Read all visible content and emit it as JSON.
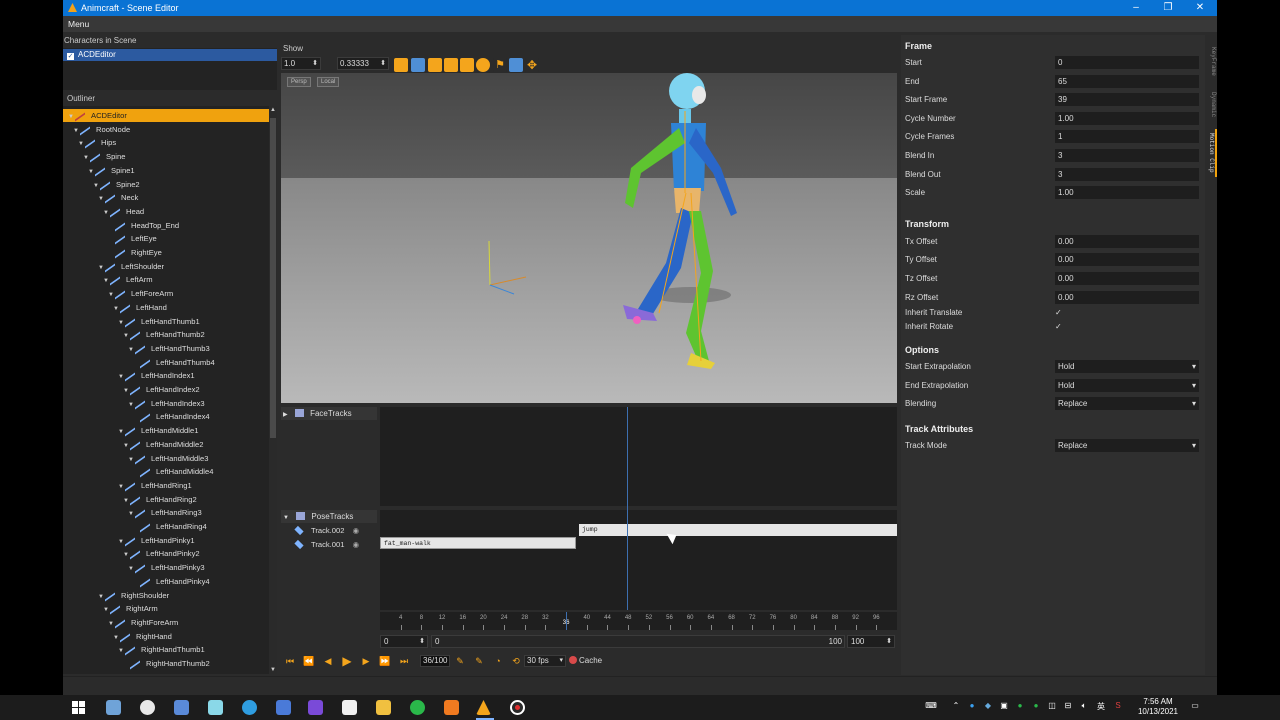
{
  "window": {
    "title": "Animcraft - Scene Editor",
    "menu": "Menu"
  },
  "characters": {
    "label": "Characters in Scene",
    "selected": "ACDEditor"
  },
  "outliner": {
    "label": "Outliner",
    "nodes": [
      {
        "name": "ACDEditor",
        "depth": 1
      },
      {
        "name": "RootNode",
        "depth": 2
      },
      {
        "name": "Hips",
        "depth": 3
      },
      {
        "name": "Spine",
        "depth": 4
      },
      {
        "name": "Spine1",
        "depth": 5
      },
      {
        "name": "Spine2",
        "depth": 6
      },
      {
        "name": "Neck",
        "depth": 7
      },
      {
        "name": "Head",
        "depth": 8
      },
      {
        "name": "HeadTop_End",
        "depth": 9
      },
      {
        "name": "LeftEye",
        "depth": 9
      },
      {
        "name": "RightEye",
        "depth": 9
      },
      {
        "name": "LeftShoulder",
        "depth": 7
      },
      {
        "name": "LeftArm",
        "depth": 8
      },
      {
        "name": "LeftForeArm",
        "depth": 9
      },
      {
        "name": "LeftHand",
        "depth": 10
      },
      {
        "name": "LeftHandThumb1",
        "depth": 11
      },
      {
        "name": "LeftHandThumb2",
        "depth": 12
      },
      {
        "name": "LeftHandThumb3",
        "depth": 13
      },
      {
        "name": "LeftHandThumb4",
        "depth": 14
      },
      {
        "name": "LeftHandIndex1",
        "depth": 11
      },
      {
        "name": "LeftHandIndex2",
        "depth": 12
      },
      {
        "name": "LeftHandIndex3",
        "depth": 13
      },
      {
        "name": "LeftHandIndex4",
        "depth": 14
      },
      {
        "name": "LeftHandMiddle1",
        "depth": 11
      },
      {
        "name": "LeftHandMiddle2",
        "depth": 12
      },
      {
        "name": "LeftHandMiddle3",
        "depth": 13
      },
      {
        "name": "LeftHandMiddle4",
        "depth": 14
      },
      {
        "name": "LeftHandRing1",
        "depth": 11
      },
      {
        "name": "LeftHandRing2",
        "depth": 12
      },
      {
        "name": "LeftHandRing3",
        "depth": 13
      },
      {
        "name": "LeftHandRing4",
        "depth": 14
      },
      {
        "name": "LeftHandPinky1",
        "depth": 11
      },
      {
        "name": "LeftHandPinky2",
        "depth": 12
      },
      {
        "name": "LeftHandPinky3",
        "depth": 13
      },
      {
        "name": "LeftHandPinky4",
        "depth": 14
      },
      {
        "name": "RightShoulder",
        "depth": 7
      },
      {
        "name": "RightArm",
        "depth": 8
      },
      {
        "name": "RightForeArm",
        "depth": 9
      },
      {
        "name": "RightHand",
        "depth": 10
      },
      {
        "name": "RightHandThumb1",
        "depth": 11
      },
      {
        "name": "RightHandThumb2",
        "depth": 12
      }
    ]
  },
  "toolbar": {
    "show_label": "Show",
    "scale_value": "1.0",
    "speed_value": "0.33333",
    "icons": [
      "cube-icon",
      "frame-icon",
      "grid-icon",
      "grid2-icon",
      "wire-icon",
      "light-icon",
      "flag-icon",
      "joint-icon",
      "move-icon"
    ]
  },
  "viewport": {
    "btn_persp": "Persp",
    "btn_local": "Local"
  },
  "tracks": {
    "face_tracks": "FaceTracks",
    "pose_tracks": "PoseTracks",
    "rows": [
      {
        "name": "Track.002"
      },
      {
        "name": "Track.001"
      }
    ],
    "clip_jump": "jump",
    "clip_walk": "fat_man-walk"
  },
  "timeline": {
    "ticks": [
      "4",
      "8",
      "12",
      "16",
      "20",
      "24",
      "28",
      "32",
      "36",
      "40",
      "44",
      "48",
      "52",
      "56",
      "60",
      "64",
      "68",
      "72",
      "76",
      "80",
      "84",
      "88",
      "92",
      "96"
    ],
    "current_marker": "36",
    "range_start": "0",
    "range_bar_start": "0",
    "range_bar_end": "100",
    "range_end": "100"
  },
  "playback": {
    "frame_display": "36/100",
    "fps": "30 fps",
    "cache_label": "Cache"
  },
  "properties": {
    "frame_section": "Frame",
    "frame_fields": [
      {
        "label": "Start",
        "value": "0"
      },
      {
        "label": "End",
        "value": "65"
      },
      {
        "label": "Start Frame",
        "value": "39"
      },
      {
        "label": "Cycle Number",
        "value": "1.00"
      },
      {
        "label": "Cycle Frames",
        "value": "1"
      },
      {
        "label": "Blend In",
        "value": "3"
      },
      {
        "label": "Blend Out",
        "value": "3"
      },
      {
        "label": "Scale",
        "value": "1.00"
      }
    ],
    "transform_section": "Transform",
    "transform_fields": [
      {
        "label": "Tx Offset",
        "value": "0.00"
      },
      {
        "label": "Ty Offset",
        "value": "0.00"
      },
      {
        "label": "Tz Offset",
        "value": "0.00"
      },
      {
        "label": "Rz Offset",
        "value": "0.00"
      }
    ],
    "inherit_translate": "Inherit Translate",
    "inherit_rotate": "Inherit Rotate",
    "options_section": "Options",
    "option_fields": [
      {
        "label": "Start Extrapolation",
        "value": "Hold"
      },
      {
        "label": "End Extrapolation",
        "value": "Hold"
      },
      {
        "label": "Blending",
        "value": "Replace"
      }
    ],
    "track_attr_section": "Track Attributes",
    "track_mode_label": "Track Mode",
    "track_mode_value": "Replace"
  },
  "side_tabs": [
    "KeyFrame",
    "Dynamic",
    "Motion Clip"
  ],
  "taskbar": {
    "time": "7:56 AM",
    "date": "10/13/2021"
  }
}
